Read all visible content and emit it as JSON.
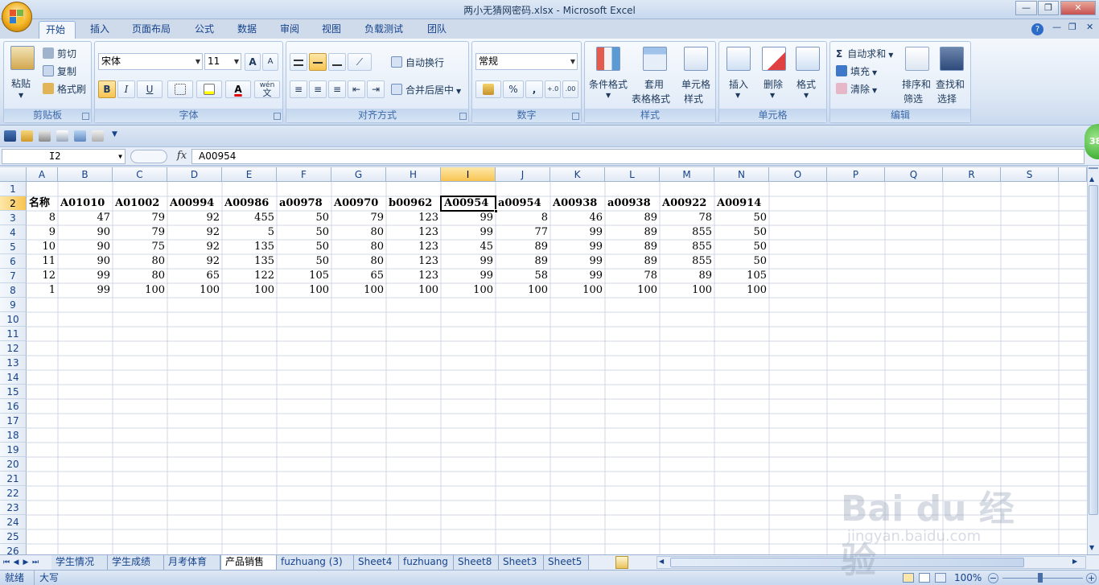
{
  "window": {
    "title": "两小无猜网密码.xlsx - Microsoft Excel",
    "buttons": [
      "—",
      "❐",
      "✕"
    ]
  },
  "ribbon_tabs": [
    "开始",
    "插入",
    "页面布局",
    "公式",
    "数据",
    "审阅",
    "视图",
    "负载测试",
    "团队"
  ],
  "active_tab": "开始",
  "groups": {
    "clipboard": {
      "label": "剪贴板",
      "paste": "粘贴",
      "cut": "剪切",
      "copy": "复制",
      "format_painter": "格式刷"
    },
    "font": {
      "label": "字体",
      "font_name": "宋体",
      "font_size": "11",
      "grow": "A",
      "shrink": "A",
      "bold": "B",
      "italic": "I",
      "underline": "U",
      "wen": "wén",
      "wen2": "文"
    },
    "alignment": {
      "label": "对齐方式",
      "wrap": "自动换行",
      "merge": "合并后居中"
    },
    "number": {
      "label": "数字",
      "format": "常规",
      "percent": "%",
      "comma": ","
    },
    "styles": {
      "label": "样式",
      "cond_l1": "条件格式",
      "table_l1": "套用",
      "table_l2": "表格格式",
      "cell_l1": "单元格",
      "cell_l2": "样式"
    },
    "cells": {
      "label": "单元格",
      "insert": "插入",
      "delete": "删除",
      "format": "格式"
    },
    "editing": {
      "label": "编辑",
      "sigma": "Σ",
      "autosum": "自动求和",
      "fill": "填充",
      "clear": "清除",
      "sort_l1": "排序和",
      "sort_l2": "筛选",
      "find_l1": "查找和",
      "find_l2": "选择"
    }
  },
  "formula_bar": {
    "name_box": "I2",
    "fx": "fx",
    "value": "A00954"
  },
  "badge": "38",
  "columns": [
    "A",
    "B",
    "C",
    "D",
    "E",
    "F",
    "G",
    "H",
    "I",
    "J",
    "K",
    "L",
    "M",
    "N",
    "O",
    "P",
    "Q",
    "R",
    "S"
  ],
  "selected_column": "I",
  "rows": [
    "1",
    "2",
    "3",
    "4",
    "5",
    "6",
    "7",
    "8",
    "9",
    "10",
    "11",
    "12",
    "13",
    "14",
    "15",
    "16",
    "17",
    "18",
    "19",
    "20",
    "21",
    "22",
    "23",
    "24",
    "25",
    "26"
  ],
  "selected_row": "2",
  "sheet": {
    "header_row": [
      "名称",
      "A01010",
      "A01002",
      "A00994",
      "A00986",
      "a00978",
      "A00970",
      "b00962",
      "A00954",
      "a00954",
      "A00938",
      "a00938",
      "A00922",
      "A00914"
    ],
    "data_rows": [
      [
        "8",
        "47",
        "79",
        "92",
        "455",
        "50",
        "79",
        "123",
        "99",
        "8",
        "46",
        "89",
        "78",
        "50"
      ],
      [
        "9",
        "90",
        "79",
        "92",
        "5",
        "50",
        "80",
        "123",
        "99",
        "77",
        "99",
        "89",
        "855",
        "50"
      ],
      [
        "10",
        "90",
        "75",
        "92",
        "135",
        "50",
        "80",
        "123",
        "45",
        "89",
        "99",
        "89",
        "855",
        "50"
      ],
      [
        "11",
        "90",
        "80",
        "92",
        "135",
        "50",
        "80",
        "123",
        "99",
        "89",
        "99",
        "89",
        "855",
        "50"
      ],
      [
        "12",
        "99",
        "80",
        "65",
        "122",
        "105",
        "65",
        "123",
        "99",
        "58",
        "99",
        "78",
        "89",
        "105"
      ],
      [
        "1",
        "99",
        "100",
        "100",
        "100",
        "100",
        "100",
        "100",
        "100",
        "100",
        "100",
        "100",
        "100",
        "100"
      ]
    ]
  },
  "sheet_tabs": [
    "学生情况",
    "学生成绩",
    "月考体育",
    "产品销售",
    "fuzhuang (3)",
    "Sheet4",
    "fuzhuang",
    "Sheet8",
    "Sheet3",
    "Sheet5"
  ],
  "active_sheet": "产品销售",
  "status": {
    "ready": "就绪",
    "caps": "大写",
    "zoom": "100%"
  },
  "watermark": {
    "main": "Bai du 经验",
    "sub": "jingyan.baidu.com"
  }
}
